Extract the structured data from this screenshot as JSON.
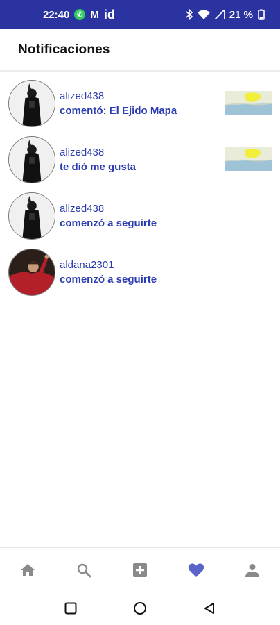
{
  "status_bar": {
    "time": "22:40",
    "id_label": "id",
    "battery": "21 %",
    "icons": [
      "whatsapp-icon",
      "gmail-icon",
      "bluetooth-icon",
      "wifi-icon",
      "signal-icon",
      "battery-icon"
    ]
  },
  "header": {
    "title": "Notificaciones"
  },
  "notifications": [
    {
      "user": "alized438",
      "action": "comentó:  El Ejido Mapa",
      "avatar": "person-photo",
      "thumbnail": "map-thumbnail"
    },
    {
      "user": "alized438",
      "action": "te dió me gusta",
      "avatar": "person-photo",
      "thumbnail": "map-thumbnail"
    },
    {
      "user": "alized438",
      "action": "comenzó a seguirte",
      "avatar": "person-photo"
    },
    {
      "user": "aldana2301",
      "action": "comenzó a seguirte",
      "avatar": "soccer-player-photo"
    }
  ],
  "bottom_nav": {
    "items": [
      "home-icon",
      "search-icon",
      "add-icon",
      "heart-icon",
      "profile-icon"
    ],
    "active": "heart-icon"
  },
  "colors": {
    "status_bar": "#2a33a0",
    "link_text": "#2b3bb0",
    "active_nav": "#5a63c8",
    "inactive_nav": "#8a8a8a"
  }
}
